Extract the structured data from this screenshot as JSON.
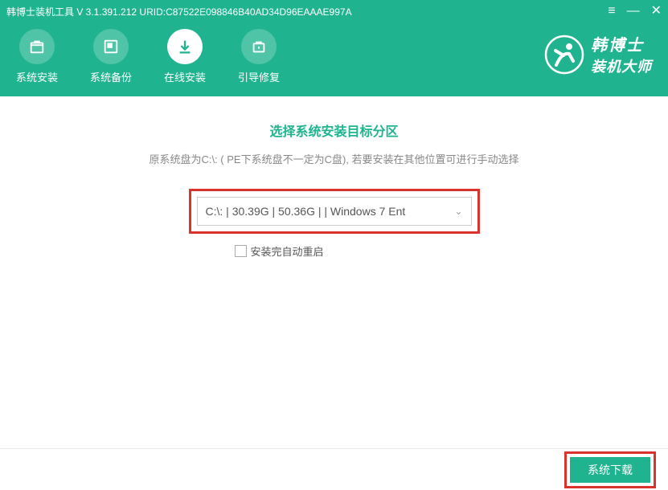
{
  "titlebar": "韩博士装机工具 V 3.1.391.212 URID:C87522E098846B40AD34D96EAAAE997A",
  "nav": {
    "items": [
      {
        "label": "系统安装"
      },
      {
        "label": "系统备份"
      },
      {
        "label": "在线安装"
      },
      {
        "label": "引导修复"
      }
    ]
  },
  "brand": {
    "line1": "韩博士",
    "line2": "装机大师"
  },
  "main": {
    "title": "选择系统安装目标分区",
    "subtitle": "原系统盘为C:\\: ( PE下系统盘不一定为C盘), 若要安装在其他位置可进行手动选择",
    "partition_value": "C:\\: | 30.39G | 50.36G |  | Windows 7 Ent",
    "checkbox_label": "安装完自动重启"
  },
  "footer": {
    "download_label": "系统下载"
  }
}
